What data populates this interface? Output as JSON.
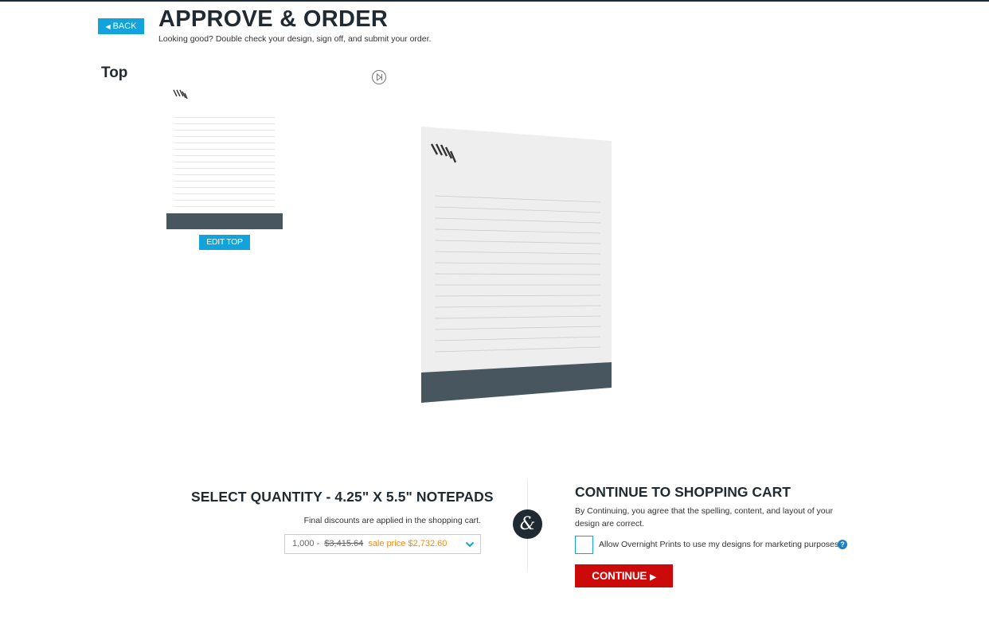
{
  "header": {
    "back_label": "BACK",
    "title": "APPROVE & ORDER",
    "subtitle": "Looking good? Double check your design, sign off, and submit your order."
  },
  "sides": {
    "label": "Top",
    "edit_label": "EDIT TOP"
  },
  "preview": {
    "play_icon": "play-next-icon",
    "logo_icon": "slash-logo-icon",
    "bar_color": "#47565f"
  },
  "quantity": {
    "title": "SELECT QUANTITY - 4.25\" X 5.5\" NOTEPADS",
    "note": "Final discounts are applied in the shopping cart.",
    "selected": {
      "qty": "1,000 -",
      "original_price": "$3,415.64",
      "sale_text": "sale price $2,732.60"
    }
  },
  "separator_glyph": "&",
  "cart": {
    "title": "CONTINUE TO SHOPPING CART",
    "note": "By Continuing, you agree that the spelling, content, and layout of your design are correct.",
    "consent_label": "Allow Overnight Prints to use my designs for marketing purposes.",
    "help_glyph": "?",
    "continue_label": "CONTINUE",
    "accent_color": "#cc0a0a"
  },
  "colors": {
    "accent_blue": "#13a3dc",
    "dark": "#1f2a33",
    "sale_orange": "#f08a1c"
  }
}
